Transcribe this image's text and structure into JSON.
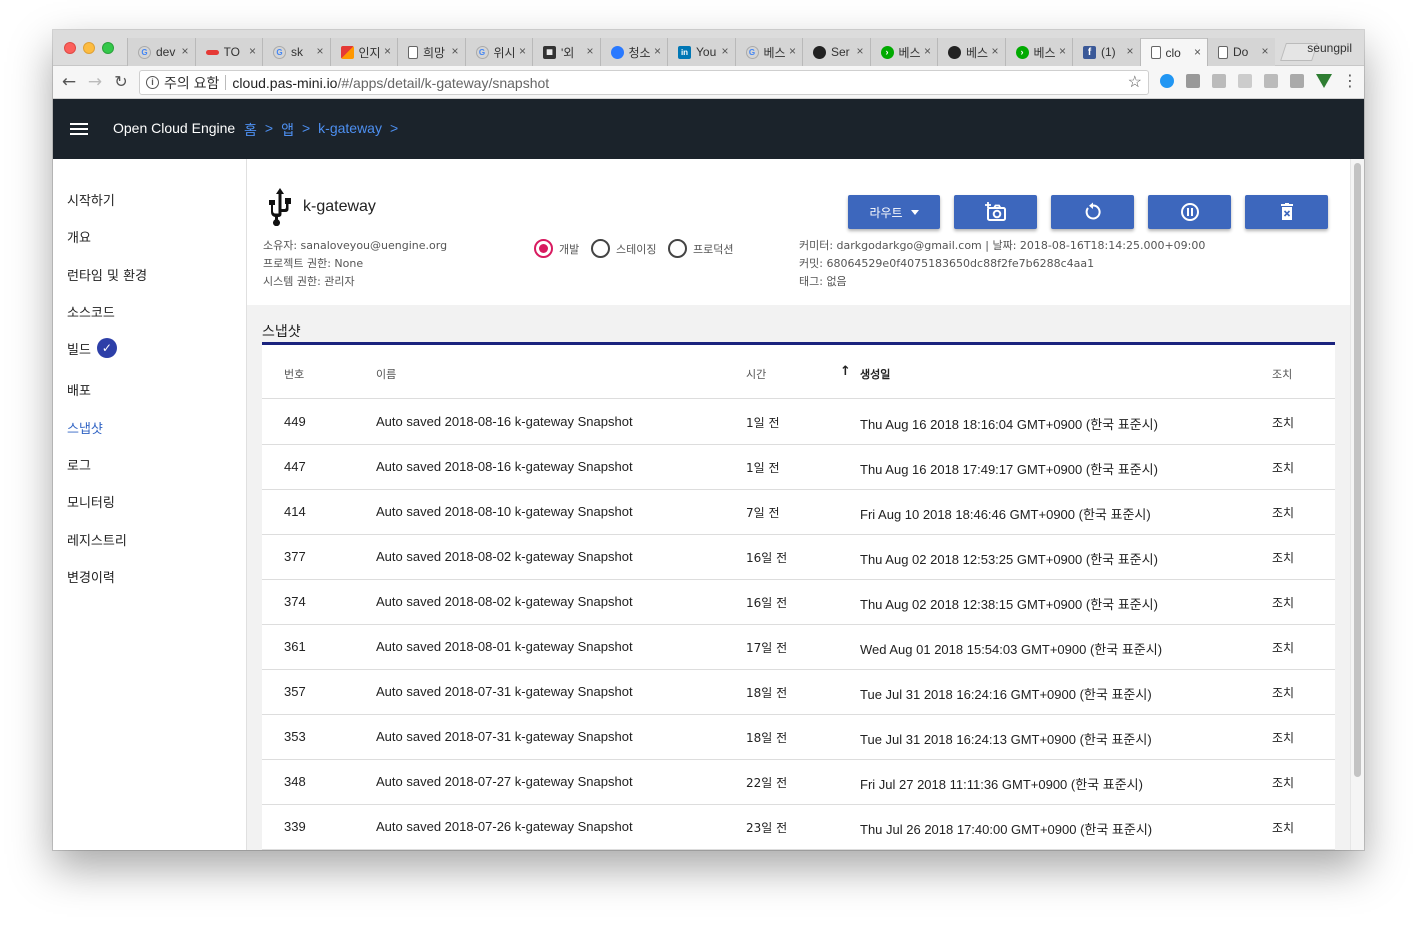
{
  "browser": {
    "tabs": [
      {
        "label": "dev",
        "icon": "google-icon"
      },
      {
        "label": "TO",
        "icon": "red-bar-icon"
      },
      {
        "label": "sk",
        "icon": "google-icon"
      },
      {
        "label": "인지",
        "icon": "flag-icon"
      },
      {
        "label": "희망",
        "icon": "doc-icon"
      },
      {
        "label": "위시",
        "icon": "google-icon"
      },
      {
        "label": "'외",
        "icon": "calendar-icon"
      },
      {
        "label": "청소",
        "icon": "hexagon-icon"
      },
      {
        "label": "You",
        "icon": "linkedin-icon"
      },
      {
        "label": "베스",
        "icon": "google-icon"
      },
      {
        "label": "Ser",
        "icon": "cloud-icon"
      },
      {
        "label": "베스",
        "icon": "arrow-icon"
      },
      {
        "label": "베스",
        "icon": "cloud-icon"
      },
      {
        "label": "베스",
        "icon": "arrow-icon"
      },
      {
        "label": "(1)",
        "icon": "facebook-icon"
      },
      {
        "label": "clo",
        "icon": "doc-icon",
        "active": true
      },
      {
        "label": "Do",
        "icon": "doc-icon"
      }
    ],
    "close_glyph": "×",
    "profile": "seungpil",
    "security_label": "주의 요함",
    "url_host": "cloud.pas-mini.io",
    "url_path": "/#/apps/detail/k-gateway/snapshot"
  },
  "header": {
    "brand": "Open Cloud Engine",
    "breadcrumbs": [
      "홈",
      ">",
      "앱",
      ">",
      "k-gateway",
      ">"
    ]
  },
  "sidebar": {
    "items": [
      {
        "label": "시작하기"
      },
      {
        "label": "개요"
      },
      {
        "label": "런타임 및 환경"
      },
      {
        "label": "소스코드"
      },
      {
        "label": "빌드",
        "badge": "check"
      },
      {
        "label": "배포"
      },
      {
        "label": "스냅샷",
        "active": true
      },
      {
        "label": "로그"
      },
      {
        "label": "모니터링"
      },
      {
        "label": "레지스트리"
      },
      {
        "label": "변경이력"
      }
    ]
  },
  "app": {
    "name": "k-gateway",
    "owner": "소유자: sanaloveyou@uengine.org",
    "project_perm": "프로젝트 권한: None",
    "system_perm": "시스템 권한: 관리자",
    "stages": [
      {
        "label": "개발",
        "selected": true
      },
      {
        "label": "스테이징",
        "selected": false
      },
      {
        "label": "프로덕션",
        "selected": false
      }
    ],
    "committer": "커미터: darkgodarkgo@gmail.com | 날짜: 2018-08-16T18:14:25.000+09:00",
    "commit": "커밋: 68064529e0f4075183650dc88f2fe7b6288c4aa1",
    "tag": "태그: 없음",
    "route_label": "라우트",
    "accent_color": "#3d67bd"
  },
  "snapshot": {
    "title": "스냅샷",
    "columns": {
      "num": "번호",
      "name": "이름",
      "time": "시간",
      "created": "생성일",
      "action": "조치"
    },
    "sort_icon": "↑",
    "rows": [
      {
        "num": "449",
        "name": "Auto saved 2018-08-16 k-gateway Snapshot",
        "time": "1일 전",
        "created": "Thu Aug 16 2018 18:16:04 GMT+0900 (한국 표준시)",
        "action": "조치"
      },
      {
        "num": "447",
        "name": "Auto saved 2018-08-16 k-gateway Snapshot",
        "time": "1일 전",
        "created": "Thu Aug 16 2018 17:49:17 GMT+0900 (한국 표준시)",
        "action": "조치"
      },
      {
        "num": "414",
        "name": "Auto saved 2018-08-10 k-gateway Snapshot",
        "time": "7일 전",
        "created": "Fri Aug 10 2018 18:46:46 GMT+0900 (한국 표준시)",
        "action": "조치"
      },
      {
        "num": "377",
        "name": "Auto saved 2018-08-02 k-gateway Snapshot",
        "time": "16일 전",
        "created": "Thu Aug 02 2018 12:53:25 GMT+0900 (한국 표준시)",
        "action": "조치"
      },
      {
        "num": "374",
        "name": "Auto saved 2018-08-02 k-gateway Snapshot",
        "time": "16일 전",
        "created": "Thu Aug 02 2018 12:38:15 GMT+0900 (한국 표준시)",
        "action": "조치"
      },
      {
        "num": "361",
        "name": "Auto saved 2018-08-01 k-gateway Snapshot",
        "time": "17일 전",
        "created": "Wed Aug 01 2018 15:54:03 GMT+0900 (한국 표준시)",
        "action": "조치"
      },
      {
        "num": "357",
        "name": "Auto saved 2018-07-31 k-gateway Snapshot",
        "time": "18일 전",
        "created": "Tue Jul 31 2018 16:24:16 GMT+0900 (한국 표준시)",
        "action": "조치"
      },
      {
        "num": "353",
        "name": "Auto saved 2018-07-31 k-gateway Snapshot",
        "time": "18일 전",
        "created": "Tue Jul 31 2018 16:24:13 GMT+0900 (한국 표준시)",
        "action": "조치"
      },
      {
        "num": "348",
        "name": "Auto saved 2018-07-27 k-gateway Snapshot",
        "time": "22일 전",
        "created": "Fri Jul 27 2018 11:11:36 GMT+0900 (한국 표준시)",
        "action": "조치"
      },
      {
        "num": "339",
        "name": "Auto saved 2018-07-26 k-gateway Snapshot",
        "time": "23일 전",
        "created": "Thu Jul 26 2018 17:40:00 GMT+0900 (한국 표준시)",
        "action": "조치"
      }
    ]
  }
}
